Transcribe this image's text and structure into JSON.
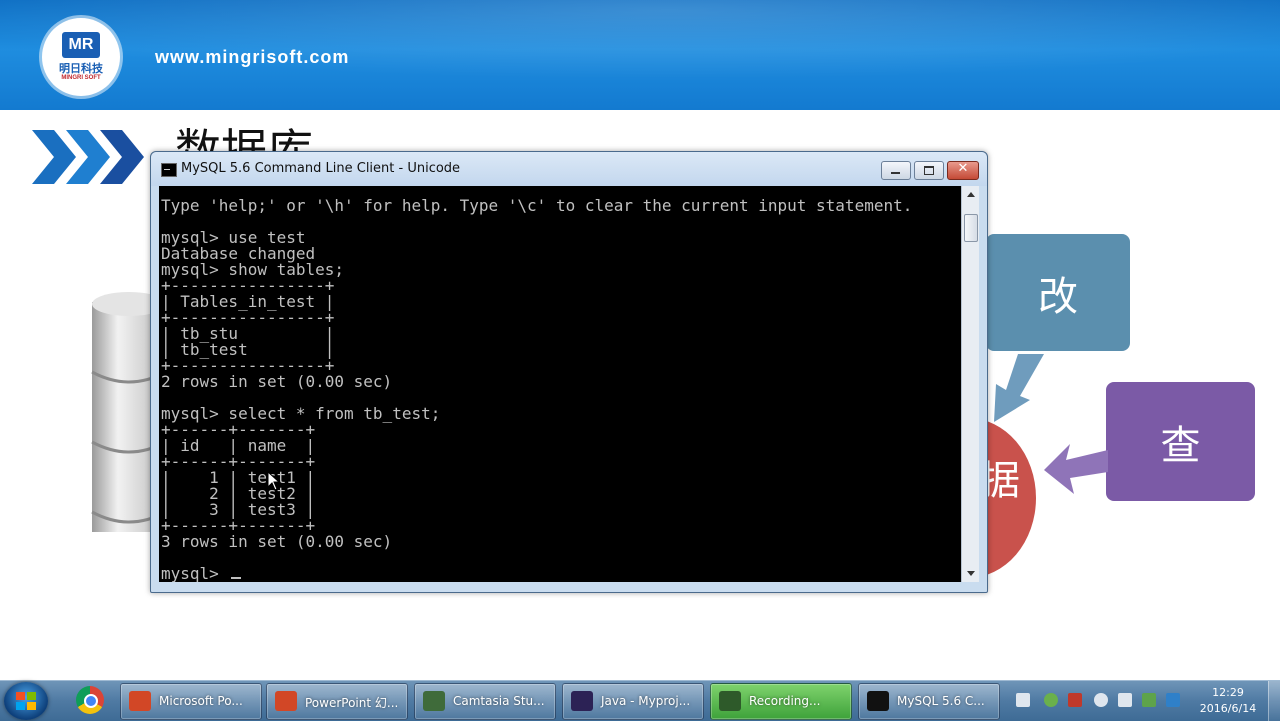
{
  "slide": {
    "logo_mark": "MR",
    "logo_cn": "明日科技",
    "logo_en": "MINGRI SOFT",
    "site_url": "www.mingrisoft.com",
    "title": "数据库",
    "box_gai": "改",
    "box_cha": "查",
    "circle_partial": "据",
    "colors": {
      "header": "#1f8ddf",
      "box_gai": "#5b8fae",
      "box_cha": "#7b5aa6",
      "circle": "#c9524c"
    }
  },
  "window": {
    "title": "MySQL 5.6 Command Line Client - Unicode",
    "close_glyph": "✕",
    "console_lines": [
      "Type 'help;' or '\\h' for help. Type '\\c' to clear the current input statement.",
      "",
      "mysql> use test",
      "Database changed",
      "mysql> show tables;",
      "+----------------+",
      "| Tables_in_test |",
      "+----------------+",
      "| tb_stu         |",
      "| tb_test        |",
      "+----------------+",
      "2 rows in set (0.00 sec)",
      "",
      "mysql> select * from tb_test;",
      "+------+-------+",
      "| id   | name  |",
      "+------+-------+",
      "|    1 | test1 |",
      "|    2 | test2 |",
      "|    3 | test3 |",
      "+------+-------+",
      "3 rows in set (0.00 sec)",
      "",
      "mysql> "
    ]
  },
  "taskbar": {
    "items": [
      {
        "label": "Microsoft Po...",
        "icon": "powerpoint-icon",
        "color": "#d24726"
      },
      {
        "label": "PowerPoint 幻...",
        "icon": "powerpoint-slideshow-icon",
        "color": "#d24726"
      },
      {
        "label": "Camtasia Stu...",
        "icon": "camtasia-icon",
        "color": "#3f6b3a"
      },
      {
        "label": "Java - Myproj...",
        "icon": "eclipse-icon",
        "color": "#2c2255"
      },
      {
        "label": "Recording...",
        "icon": "recording-icon",
        "color": "#2e5a2a"
      },
      {
        "label": "MySQL 5.6 C...",
        "icon": "mysql-console-icon",
        "color": "#111111"
      }
    ],
    "clock_time": "12:29",
    "clock_date": "2016/6/14"
  }
}
